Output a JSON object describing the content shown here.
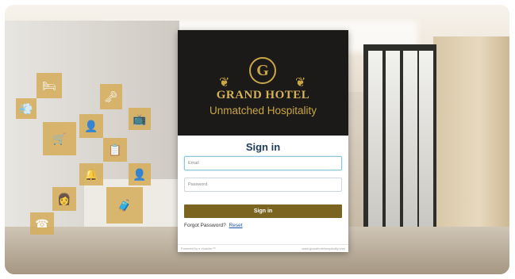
{
  "card": {
    "logo_letter": "G",
    "brand_name": "GRAND HOTEL",
    "tagline": "Unmatched Hospitality",
    "title": "Sign in",
    "email_placeholder": "Email",
    "password_placeholder": "Password",
    "signin_label": "Sign in",
    "forgot_text": "Forgot Password?",
    "reset_link": "Reset",
    "footer_left": "Powered by e-Hotelier™",
    "footer_right": "www.grandhotelhospitality.com"
  },
  "colors": {
    "accent_gold": "#c9a646",
    "button": "#7a6420",
    "title_blue": "#1f3a5a",
    "link": "#2255a4"
  }
}
